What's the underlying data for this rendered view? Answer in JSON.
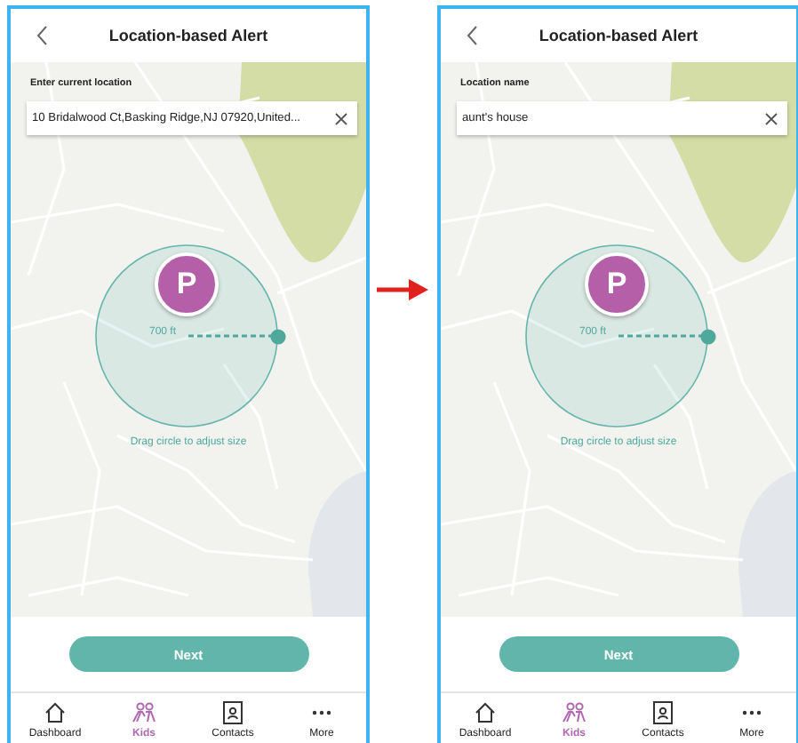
{
  "screens": [
    {
      "header": {
        "title": "Location-based Alert"
      },
      "field": {
        "label": "Enter current location",
        "value": "10 Bridalwood Ct,Basking Ridge,NJ 07920,United..."
      },
      "marker": {
        "letter": "P"
      },
      "radius": {
        "reading": "700 ft"
      },
      "hint": "Drag circle to adjust size",
      "button": "Next",
      "tabs": [
        {
          "label": "Dashboard",
          "kind": "home",
          "selected": false
        },
        {
          "label": "Kids",
          "kind": "kids",
          "selected": true
        },
        {
          "label": "Contacts",
          "kind": "contacts",
          "selected": false
        },
        {
          "label": "More",
          "kind": "more",
          "selected": false
        }
      ]
    },
    {
      "header": {
        "title": "Location-based Alert"
      },
      "field": {
        "label": "Location name",
        "value": "aunt's house"
      },
      "marker": {
        "letter": "P"
      },
      "radius": {
        "reading": "700 ft"
      },
      "hint": "Drag circle to adjust size",
      "button": "Next",
      "tabs": [
        {
          "label": "Dashboard",
          "kind": "home",
          "selected": false
        },
        {
          "label": "Kids",
          "kind": "kids",
          "selected": true
        },
        {
          "label": "Contacts",
          "kind": "contacts",
          "selected": false
        },
        {
          "label": "More",
          "kind": "more",
          "selected": false
        }
      ]
    }
  ]
}
